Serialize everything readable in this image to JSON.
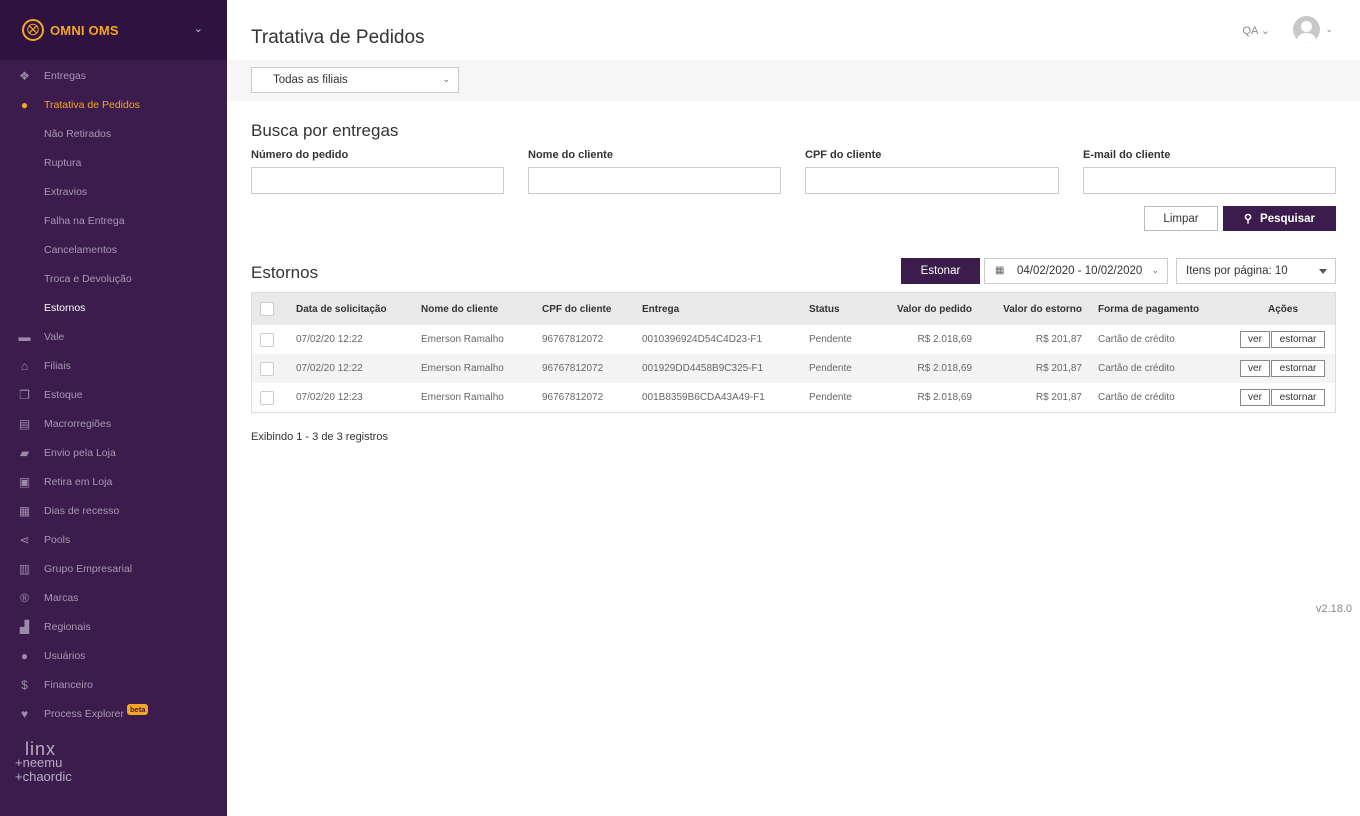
{
  "brand": {
    "name": "OMNI OMS",
    "logo_icon": "cart-icon"
  },
  "sidebar": {
    "items": [
      {
        "label": "Entregas",
        "icon": "dropbox-icon",
        "glyph": "❖",
        "state": "normal",
        "sub": false
      },
      {
        "label": "Tratativa de Pedidos",
        "icon": "user-circle-icon",
        "glyph": "●",
        "state": "active",
        "sub": false
      },
      {
        "label": "Não Retirados",
        "sub": true,
        "state": "normal"
      },
      {
        "label": "Ruptura",
        "sub": true,
        "state": "normal"
      },
      {
        "label": "Extravios",
        "sub": true,
        "state": "normal"
      },
      {
        "label": "Falha na Entrega",
        "sub": true,
        "state": "normal"
      },
      {
        "label": "Cancelamentos",
        "sub": true,
        "state": "normal"
      },
      {
        "label": "Troca e Devolução",
        "sub": true,
        "state": "normal"
      },
      {
        "label": "Estornos",
        "sub": true,
        "state": "selected"
      },
      {
        "label": "Vale",
        "icon": "credit-card-icon",
        "glyph": "▬",
        "state": "normal",
        "sub": false
      },
      {
        "label": "Filiais",
        "icon": "home-icon",
        "glyph": "⌂",
        "state": "normal",
        "sub": false
      },
      {
        "label": "Estoque",
        "icon": "cubes-icon",
        "glyph": "❒",
        "state": "normal",
        "sub": false
      },
      {
        "label": "Macrorregiões",
        "icon": "map-icon",
        "glyph": "▤",
        "state": "normal",
        "sub": false
      },
      {
        "label": "Envio pela Loja",
        "icon": "truck-icon",
        "glyph": "▰",
        "state": "normal",
        "sub": false
      },
      {
        "label": "Retira em Loja",
        "icon": "shopping-bag-icon",
        "glyph": "▣",
        "state": "normal",
        "sub": false
      },
      {
        "label": "Dias de recesso",
        "icon": "calendar-icon",
        "glyph": "▦",
        "state": "normal",
        "sub": false
      },
      {
        "label": "Pools",
        "icon": "share-icon",
        "glyph": "⋖",
        "state": "normal",
        "sub": false
      },
      {
        "label": "Grupo Empresarial",
        "icon": "building-icon",
        "glyph": "▥",
        "state": "normal",
        "sub": false
      },
      {
        "label": "Marcas",
        "icon": "registered-icon",
        "glyph": "®",
        "state": "normal",
        "sub": false
      },
      {
        "label": "Regionais",
        "icon": "bank-icon",
        "glyph": "▟",
        "state": "normal",
        "sub": false
      },
      {
        "label": "Usuários",
        "icon": "users-icon",
        "glyph": "●",
        "state": "normal",
        "sub": false
      },
      {
        "label": "Financeiro",
        "icon": "dollar-icon",
        "glyph": "$",
        "state": "normal",
        "sub": false
      },
      {
        "label": "Process Explorer",
        "icon": "heartbeat-icon",
        "glyph": "♥",
        "state": "normal",
        "sub": false,
        "badge": "beta"
      }
    ],
    "footer": {
      "line1": "linx",
      "line2": "+neemu",
      "line3": "+chaordic"
    }
  },
  "header": {
    "title": "Tratativa de Pedidos",
    "env": "QA ⌄",
    "user_icon": "user-avatar-icon"
  },
  "filter": {
    "filial": "Todas as filiais"
  },
  "search": {
    "title": "Busca por entregas",
    "fields": [
      {
        "label": "Número do pedido",
        "value": ""
      },
      {
        "label": "Nome do cliente",
        "value": ""
      },
      {
        "label": "CPF do cliente",
        "value": ""
      },
      {
        "label": "E-mail do cliente",
        "value": ""
      }
    ],
    "clear_label": "Limpar",
    "search_label": "Pesquisar"
  },
  "refunds": {
    "title": "Estornos",
    "refund_button": "Estonar",
    "date_range": "04/02/2020 - 10/02/2020",
    "per_page": "Itens por página: 10",
    "columns": [
      "Data de solicitação",
      "Nome do cliente",
      "CPF do cliente",
      "Entrega",
      "Status",
      "Valor do pedido",
      "Valor do estorno",
      "Forma de pagamento",
      "Ações"
    ],
    "rows": [
      {
        "date": "07/02/20 12:22",
        "name": "Emerson Ramalho",
        "cpf": "96767812072",
        "delivery": "0010396924D54C4D23-F1",
        "status": "Pendente",
        "order_value": "R$ 2.018,69",
        "refund_value": "R$ 201,87",
        "payment": "Cartão de crédito",
        "view": "ver",
        "refund": "estornar"
      },
      {
        "date": "07/02/20 12:22",
        "name": "Emerson Ramalho",
        "cpf": "96767812072",
        "delivery": "001929DD4458B9C325-F1",
        "status": "Pendente",
        "order_value": "R$ 2.018,69",
        "refund_value": "R$ 201,87",
        "payment": "Cartão de crédito",
        "view": "ver",
        "refund": "estornar"
      },
      {
        "date": "07/02/20 12:23",
        "name": "Emerson Ramalho",
        "cpf": "96767812072",
        "delivery": "001B8359B6CDA43A49-F1",
        "status": "Pendente",
        "order_value": "R$ 2.018,69",
        "refund_value": "R$ 201,87",
        "payment": "Cartão de crédito",
        "view": "ver",
        "refund": "estornar"
      }
    ],
    "info": "Exibindo 1 - 3 de 3 registros"
  },
  "version": "v2.18.0"
}
